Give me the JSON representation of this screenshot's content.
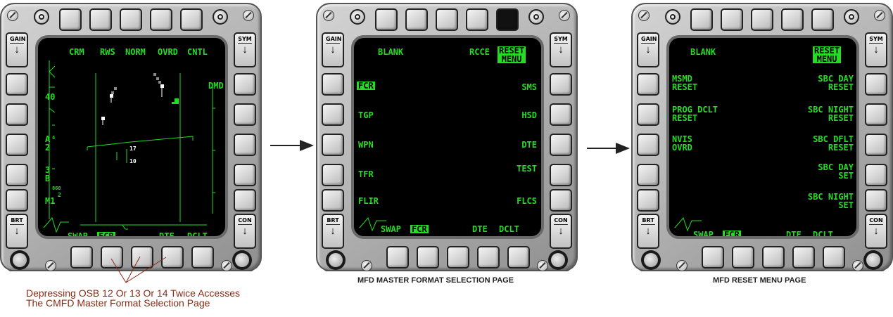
{
  "mfd1": {
    "top_labels": [
      "CRM",
      "RWS",
      "NORM",
      "OVRD",
      "CNTL"
    ],
    "right_label": "DMD",
    "bottom_labels": {
      "swap": "SWAP",
      "fcr": "FCR",
      "dte": "DTE",
      "dclt": "DCLT"
    },
    "scale_left": {
      "range": "40",
      "a": "A",
      "a_sub": "4",
      "two": "2",
      "three": "3",
      "b": "B",
      "ab_alt": "868",
      "m": "M1",
      "m_sub": "2"
    },
    "readouts": {
      "r1": "17",
      "r2": "10"
    }
  },
  "mfd2": {
    "top_left": "BLANK",
    "top_right": "RCCE",
    "reset_menu": [
      "RESET",
      "MENU"
    ],
    "left_labels": [
      "FCR",
      "TGP",
      "WPN",
      "TFR",
      "FLIR"
    ],
    "right_labels": [
      "SMS",
      "HSD",
      "DTE",
      "TEST",
      "FLCS"
    ],
    "bottom_labels": {
      "swap": "SWAP",
      "fcr": "FCR",
      "dte": "DTE",
      "dclt": "DCLT"
    },
    "caption": "MFD MASTER FORMAT SELECTION PAGE"
  },
  "mfd3": {
    "top_left": "BLANK",
    "reset_menu": [
      "RESET",
      "MENU"
    ],
    "left_labels": [
      [
        "MSMD",
        "RESET"
      ],
      [
        "PROG DCLT",
        "RESET"
      ],
      [
        "NVIS",
        "OVRD"
      ]
    ],
    "right_labels": [
      [
        "SBC DAY",
        "RESET"
      ],
      [
        "SBC NIGHT",
        "RESET"
      ],
      [
        "SBC DFLT",
        "RESET"
      ],
      [
        "SBC DAY",
        "SET"
      ],
      [
        "SBC NIGHT",
        "SET"
      ]
    ],
    "bottom_labels": {
      "swap": "SWAP",
      "fcr": "FCR",
      "dte": "DTE",
      "dclt": "DCLT"
    },
    "caption": "MFD  RESET MENU PAGE"
  },
  "rockers": {
    "gain": "GAIN",
    "sym": "SYM",
    "brt": "BRT",
    "con": "CON",
    "arrow": "↓"
  },
  "annotation": [
    "Depressing OSB 12 Or 13  Or 14 Twice  Accesses",
    "The CMFD  Master Format Selection Page"
  ],
  "colors": {
    "display_green": "#22dd22",
    "annotation_text": "#8b2b14",
    "bezel_gray": "#b6b6b6"
  }
}
